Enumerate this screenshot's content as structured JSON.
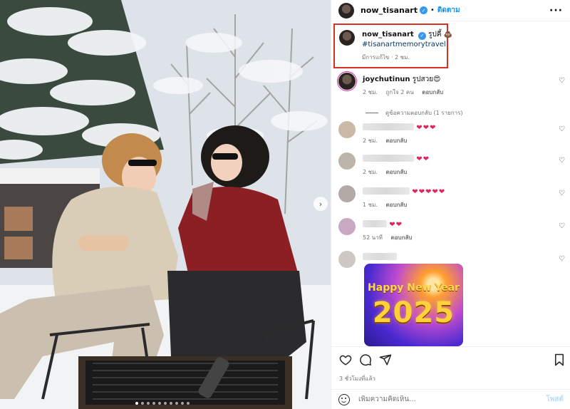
{
  "post": {
    "username": "now_tisanart",
    "separator": "•",
    "follow_label": "ติดตาม",
    "more_label": "···",
    "carousel_next_glyph": "›",
    "caption": {
      "username": "now_tisanart",
      "text": "รูปคี้ 💩",
      "hashtag": "#tisanartmemorytravel",
      "meta": "มีการแก้ไข · 2 ชม."
    },
    "comments": [
      {
        "username": "joychutinun",
        "text": "รูปสวย😍",
        "time": "2 ชม.",
        "likes": "ถูกใจ 2 คน",
        "reply": "ตอบกลับ",
        "view_replies": "ดูข้อความตอบกลับ (1 รายการ)"
      },
      {
        "hearts": "❤❤❤",
        "time": "2 ชม.",
        "reply": "ตอบกลับ"
      },
      {
        "hearts": "❤❤",
        "time": "2 ชม.",
        "reply": "ตอบกลับ"
      },
      {
        "hearts": "❤❤❤❤❤",
        "time": "1 ชม.",
        "reply": "ตอบกลับ"
      },
      {
        "hearts": "❤❤",
        "time": "52 นาที",
        "reply": "ตอบกลับ"
      },
      {
        "image_title": "Happy New Year",
        "image_year": "2025"
      }
    ],
    "time_ago": "3 ชั่วโมงที่แล้ว",
    "add_comment_placeholder": "เพิ่มความคิดเห็น...",
    "post_label": "โพสต์"
  },
  "icons": [
    "heart-icon",
    "comment-icon",
    "share-icon",
    "bookmark-icon",
    "emoji-icon",
    "verified-icon"
  ],
  "colors": {
    "link": "#0095f6",
    "highlight_box": "#d93025",
    "heart": "#e0245e",
    "verified": "#3897f0"
  }
}
